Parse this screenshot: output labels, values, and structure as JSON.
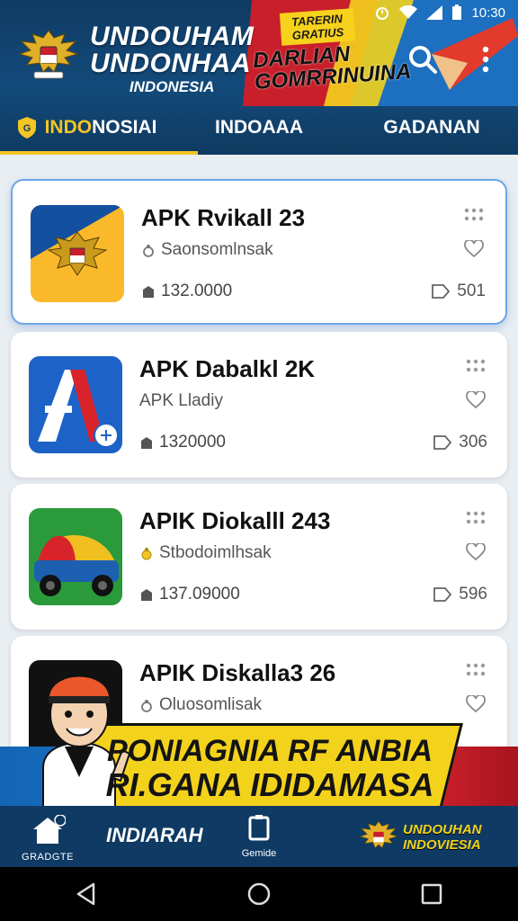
{
  "status_bar": {
    "time": "10:30"
  },
  "header": {
    "brand_line1": "UNDOUHAM",
    "brand_line2": "UNDONHAA",
    "brand_line3": "INDONESIA",
    "promo_tag": "TARERIN GRATIUS",
    "promo_title_line1": "DARLIAN",
    "promo_title_line2": "GOMRRINUINA"
  },
  "tabs": [
    {
      "label_prefix": "INDO",
      "label_rest": "NOSIAI",
      "active": true
    },
    {
      "label": "INDOAAA",
      "active": false
    },
    {
      "label": "GADANAN",
      "active": false
    }
  ],
  "apps": [
    {
      "title": "APK Rvikall 23",
      "developer": "Saonsomlnsak",
      "downloads": "132.0000",
      "count": "501",
      "selected": true
    },
    {
      "title": "APK Dabalkl 2K",
      "developer": "APK  Lladiy",
      "downloads": "1320000",
      "count": "306",
      "selected": false
    },
    {
      "title": "APIK Diokalll 243",
      "developer": "Stbodoimlhsak",
      "downloads": "137.09000",
      "count": "596",
      "selected": false
    },
    {
      "title": "APIK Diskalla3 26",
      "developer": "Oluosomlisak",
      "downloads": "",
      "count": "",
      "selected": false
    }
  ],
  "banner": {
    "line1": "PONIAGNIA RF ANBIA",
    "line2": "RI.GANA IDIDAMASA"
  },
  "bottom_nav": {
    "home_caption": "GRADGTE",
    "main_label": "INDIARAH",
    "center_caption": "Gemide",
    "brand_line1": "UNDOUHAN",
    "brand_line2": "INDOVIESIA"
  },
  "colors": {
    "header_bg": "#134a7a",
    "accent": "#f3c623",
    "banner_yellow": "#f3d21c",
    "brand_red": "#c81f2a"
  },
  "icons": [
    "garuda-emblem",
    "search-icon",
    "more-vert-icon",
    "shield-icon",
    "grip-icon",
    "heart-icon",
    "download-icon",
    "home-icon",
    "square-icon",
    "back-icon",
    "circle-home-icon",
    "recents-icon"
  ]
}
